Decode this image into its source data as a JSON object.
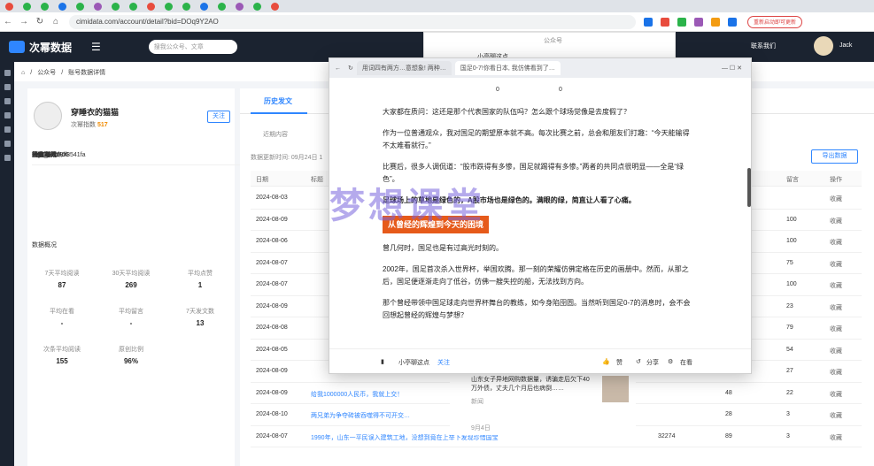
{
  "browser": {
    "url": "cimidata.com/account/detail?bid=DOq9Y2AO",
    "update_button": "重新启动即可更新"
  },
  "site": {
    "logo": "次幂数据",
    "search_placeholder": "搜我公众号、文章",
    "contact": "联系我们",
    "user": "Jack"
  },
  "breadcrumb": [
    "公众号",
    "账号数据详情"
  ],
  "account": {
    "name": "穿睡衣的猫猫",
    "index_label": "次幂指数",
    "index_value": "517",
    "follow": "关注",
    "info": [
      {
        "k": "微信号:",
        "v": "gh_b8b7df8541fa"
      },
      {
        "k": "简介:",
        "v": "-"
      },
      {
        "k": "帐号主体:",
        "v": "个人"
      },
      {
        "k": "注册时间:",
        "v": "2024-03-06"
      },
      {
        "k": "发文时段:",
        "v": "6:00-7:00"
      },
      {
        "k": "所属领域:",
        "v": "搞笑热点"
      }
    ],
    "section_title": "数据概况",
    "stats": [
      {
        "label": "7天平均阅读",
        "value": "87"
      },
      {
        "label": "30天平均阅读",
        "value": "269"
      },
      {
        "label": "平均点赞",
        "value": "1"
      },
      {
        "label": "平均在看",
        "value": "-"
      },
      {
        "label": "平均留言",
        "value": "-"
      },
      {
        "label": "7天发文数",
        "value": "13"
      },
      {
        "label": "次条平均阅读",
        "value": "155"
      },
      {
        "label": "原创比例",
        "value": "96%"
      }
    ]
  },
  "articles": {
    "tab": "历史发文",
    "recent": "近期内容",
    "update_time": "数据更新时间: 09月24日 1",
    "export": "导出数据",
    "headers": {
      "date": "日期",
      "title": "标题",
      "comment": "留言",
      "action": "操作"
    },
    "rows": [
      {
        "date": "2024-08-03",
        "title": "",
        "read": "",
        "like": "",
        "comment": "",
        "fav": "收藏"
      },
      {
        "date": "2024-08-09",
        "title": "",
        "read": "",
        "like": "",
        "comment": "100",
        "fav": "收藏"
      },
      {
        "date": "2024-08-06",
        "title": "",
        "read": "",
        "like": "",
        "comment": "100",
        "fav": "收藏"
      },
      {
        "date": "2024-08-07",
        "title": "",
        "read": "",
        "like": "",
        "comment": "75",
        "fav": "收藏"
      },
      {
        "date": "2024-08-07",
        "title": "",
        "read": "",
        "like": "",
        "comment": "100",
        "fav": "收藏"
      },
      {
        "date": "2024-08-09",
        "title": "",
        "read": "",
        "like": "",
        "comment": "23",
        "fav": "收藏"
      },
      {
        "date": "2024-08-08",
        "title": "",
        "read": "",
        "like": "",
        "comment": "79",
        "fav": "收藏"
      },
      {
        "date": "2024-08-05",
        "title": "",
        "read": "",
        "like": "",
        "comment": "54",
        "fav": "收藏"
      },
      {
        "date": "2024-08-09",
        "title": "",
        "read": "",
        "like": "96",
        "comment": "27",
        "fav": "收藏"
      },
      {
        "date": "2024-08-09",
        "title": "给我1000000人民币，我就上交！",
        "read": "",
        "like": "48",
        "comment": "22",
        "fav": "收藏"
      },
      {
        "date": "2024-08-10",
        "title": "两兄弟为争夺砖被吞噬得不可开交…",
        "read": "",
        "like": "28",
        "comment": "3",
        "fav": "收藏"
      },
      {
        "date": "2024-08-07",
        "title": "1990年，山东一平民误入建筑工地，没想到竟在上举下发现珍惜国宝",
        "read": "32274",
        "like": "89",
        "comment": "3",
        "fav": "收藏"
      }
    ]
  },
  "popup": {
    "tab1": "用词四有两方…意想象! 两种…",
    "tab2": "国足0-7!你看日本, 我仿佛看到了…",
    "counts": [
      "0",
      "0"
    ],
    "paragraphs": [
      "大家都在质问：这还是那个代表国家的队伍吗？怎么跟个球场觉像是去度假了？",
      "作为一位普通观众，我对国足的期望原本就不高。每次比赛之前，总会和朋友们打趣：“今天能输得不太难看就行。”",
      "比赛后，很多人调侃道：“股市跌得有多惨，国足就踢得有多惨。”两者的共同点很明显——全是“绿色”。",
      "足球场上的草地是绿色的，A股市场也是绿色的。满眼的绿，简直让人看了心痛。"
    ],
    "banner": "从曾经的辉煌到今天的困境",
    "paragraphs2": [
      "曾几何时，国足也是有过高光时刻的。",
      "2002年，国足首次杀入世界杯，举国欢腾。那一刻的荣耀仿佛定格在历史的画册中。然而，从那之后，国足便逐渐走向了低谷，仿佛一艘失控的船，无法找到方向。",
      "那个曾经带领中国足球走向世界杯舞台的教练，如今身陷囹圄。当然听到国足0-7的消息时，会不会回想起曾经的辉煌与梦想？"
    ],
    "footer_author": "小亭聊这点",
    "footer_follow": "关注",
    "footer_like": "赞",
    "footer_share": "分享",
    "footer_view": "在看"
  },
  "bg_popup": {
    "label": "公众号",
    "text": "小亭聊这点",
    "news": "山东女子异地网购数据量，诱骗走后欠下40万外债，丈夫几个月后也病倒……",
    "source": "新闻",
    "section": "9月4日"
  },
  "watermark": "梦想课堂"
}
